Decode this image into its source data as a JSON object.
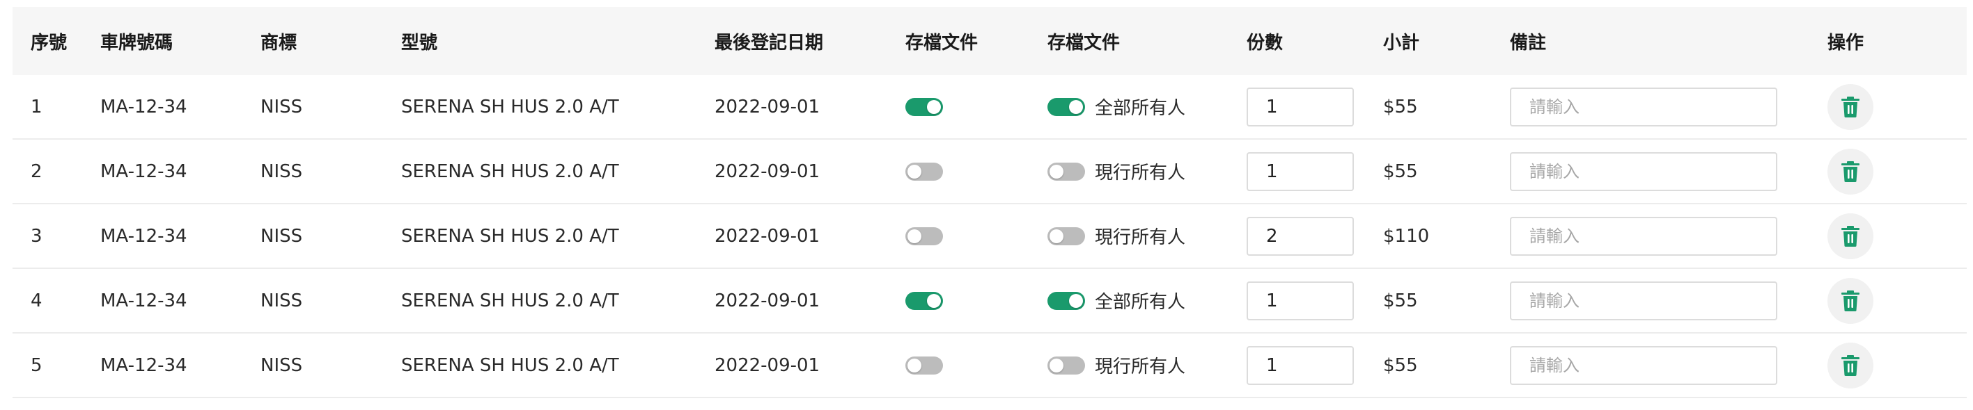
{
  "table": {
    "headers": {
      "index": "序號",
      "plate": "車牌號碼",
      "brand": "商標",
      "model": "型號",
      "last_reg": "最後登記日期",
      "archive1": "存檔文件",
      "archive2": "存檔文件",
      "copies": "份數",
      "subtotal": "小計",
      "remark": "備註",
      "action": "操作"
    },
    "rows": [
      {
        "index": "1",
        "plate": "MA-12-34",
        "brand": "NISS",
        "model": "SERENA SH HUS 2.0 A/T",
        "last_reg": "2022-09-01",
        "toggle1_on": true,
        "toggle2_on": true,
        "owner_label": "全部所有人",
        "copies": "1",
        "subtotal": "$55",
        "remark": "",
        "remark_placeholder": "請輸入"
      },
      {
        "index": "2",
        "plate": "MA-12-34",
        "brand": "NISS",
        "model": "SERENA SH HUS 2.0 A/T",
        "last_reg": "2022-09-01",
        "toggle1_on": false,
        "toggle2_on": false,
        "owner_label": "現行所有人",
        "copies": "1",
        "subtotal": "$55",
        "remark": "",
        "remark_placeholder": "請輸入"
      },
      {
        "index": "3",
        "plate": "MA-12-34",
        "brand": "NISS",
        "model": "SERENA SH HUS 2.0 A/T",
        "last_reg": "2022-09-01",
        "toggle1_on": false,
        "toggle2_on": false,
        "owner_label": "現行所有人",
        "copies": "2",
        "subtotal": "$110",
        "remark": "",
        "remark_placeholder": "請輸入"
      },
      {
        "index": "4",
        "plate": "MA-12-34",
        "brand": "NISS",
        "model": "SERENA SH HUS 2.0 A/T",
        "last_reg": "2022-09-01",
        "toggle1_on": true,
        "toggle2_on": true,
        "owner_label": "全部所有人",
        "copies": "1",
        "subtotal": "$55",
        "remark": "",
        "remark_placeholder": "請輸入"
      },
      {
        "index": "5",
        "plate": "MA-12-34",
        "brand": "NISS",
        "model": "SERENA SH HUS 2.0 A/T",
        "last_reg": "2022-09-01",
        "toggle1_on": false,
        "toggle2_on": false,
        "owner_label": "現行所有人",
        "copies": "1",
        "subtotal": "$55",
        "remark": "",
        "remark_placeholder": "請輸入"
      }
    ],
    "delete_icon": "trash-icon"
  },
  "colors": {
    "accent": "#1a9a6c",
    "toggle_off": "#bcbcbc",
    "header_bg": "#f6f6f6"
  }
}
